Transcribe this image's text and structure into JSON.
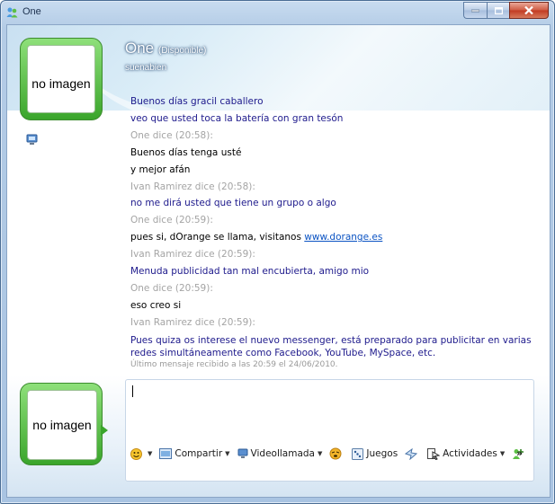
{
  "window": {
    "title": "One"
  },
  "contact": {
    "name": "One",
    "status": "(Disponible)",
    "personal_message": "suenabien"
  },
  "avatars": {
    "contact_placeholder": "no imagen",
    "self_placeholder": "no imagen"
  },
  "conversation": {
    "lines": [
      {
        "kind": "msg-blue",
        "text": "Buenos días gracil caballero"
      },
      {
        "kind": "msg-blue",
        "text": "veo que usted toca la batería con gran tesón"
      },
      {
        "kind": "header",
        "text": "One dice (20:58):"
      },
      {
        "kind": "msg-black",
        "text": "Buenos días tenga usté"
      },
      {
        "kind": "msg-black",
        "text": "y mejor afán"
      },
      {
        "kind": "header",
        "text": "Ivan Ramirez dice (20:58):"
      },
      {
        "kind": "msg-blue",
        "text": "no me dirá usted que tiene un grupo o algo"
      },
      {
        "kind": "header",
        "text": "One dice (20:59):"
      },
      {
        "kind": "msg-black-link",
        "text": "pues si, dOrange se llama, visitanos ",
        "link": "www.dorange.es"
      },
      {
        "kind": "header",
        "text": "Ivan Ramirez dice (20:59):"
      },
      {
        "kind": "msg-blue",
        "text": "Menuda publicidad tan mal encubierta, amigo mio"
      },
      {
        "kind": "header",
        "text": "One dice (20:59):"
      },
      {
        "kind": "msg-black",
        "text": "eso creo si"
      },
      {
        "kind": "header",
        "text": "Ivan Ramirez dice (20:59):"
      },
      {
        "kind": "msg-blue-wrap",
        "text": "Pues quiza os interese el nuevo messenger, está preparado para publicitar en varias redes simultáneamente como Facebook, YouTube, MySpace, etc."
      }
    ],
    "last_received": "Último mensaje recibido a las 20:59 el 24/06/2010."
  },
  "input": {
    "value": ""
  },
  "toolbar": {
    "share_label": "Compartir",
    "video_label": "Videollamada",
    "games_label": "Juegos",
    "activities_label": "Actividades",
    "more_label": "»"
  },
  "colors": {
    "frame": "#b4cce6",
    "own_message": "#1e1a8c",
    "contact_message": "#000000",
    "header_text": "#a4a4a4",
    "link": "#0b53c3",
    "avatar_frame": "#3aa52b"
  }
}
